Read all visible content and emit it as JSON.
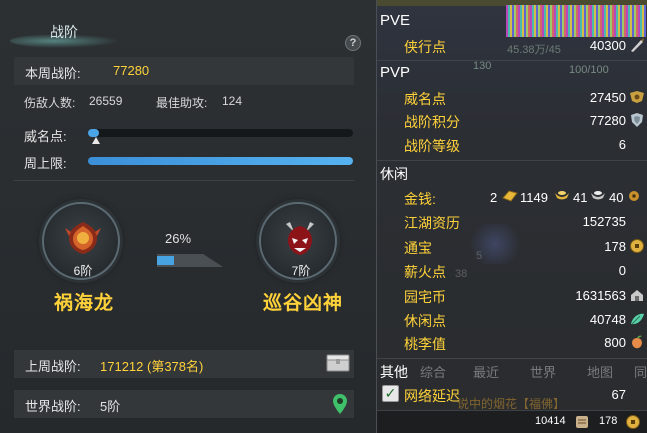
{
  "left": {
    "title": "战阶",
    "help": "?",
    "week_label": "本周战阶:",
    "week_value": "77280",
    "kills_label": "伤敌人数:",
    "kills_value": "26559",
    "assist_label": "最佳助攻:",
    "assist_value": "124",
    "fame_label": "威名点:",
    "fame_progress": 0.03,
    "cap_label": "周上限:",
    "cap_progress": 1.0,
    "current_rank": {
      "tier": "6阶",
      "name": "祸海龙"
    },
    "next_rank": {
      "tier": "7阶",
      "name": "巡谷凶神"
    },
    "progress_pct": "26%",
    "progress_value": 0.26,
    "last_week_label": "上周战阶:",
    "last_week_value": "171212 (第378名)",
    "world_label": "世界战阶:",
    "world_value": "5阶"
  },
  "right": {
    "pve_header": "PVE",
    "pvp_header": "PVP",
    "idle_header": "休闲",
    "other_header": "其他",
    "hp_overlay": "45.38万/45",
    "pvp_overlay_bar": "100/100",
    "pvp_overlay_level": "130",
    "pve_stats": [
      {
        "label": "侠行点",
        "value": "40300",
        "icon": "feather-icon"
      }
    ],
    "pvp_stats": [
      {
        "label": "威名点",
        "value": "27450",
        "icon": "crest-icon"
      },
      {
        "label": "战阶积分",
        "value": "77280",
        "icon": "shield-icon"
      },
      {
        "label": "战阶等级",
        "value": "6",
        "icon": ""
      }
    ],
    "money": {
      "label": "金钱:",
      "gold_bar": "2",
      "gold": "1149",
      "silver": "41",
      "copper": "40"
    },
    "idle_stats": [
      {
        "label": "江湖资历",
        "value": "152735",
        "icon": ""
      },
      {
        "label": "通宝",
        "value": "178",
        "icon": "coin-icon"
      },
      {
        "label": "薪火点",
        "value": "0",
        "icon": ""
      },
      {
        "label": "园宅币",
        "value": "1631563",
        "icon": "house-coin-icon"
      },
      {
        "label": "休闲点",
        "value": "40748",
        "icon": "leaf-icon"
      },
      {
        "label": "桃李值",
        "value": "800",
        "icon": "peach-icon"
      }
    ],
    "chat_tabs": [
      "综合",
      "最近",
      "世界",
      "地图",
      "同"
    ],
    "latency_label": "网络延迟",
    "latency_value": "67",
    "chat_ghost": "说中的烟花【福佛】",
    "bottom_a": "10414",
    "bottom_b": "178"
  }
}
